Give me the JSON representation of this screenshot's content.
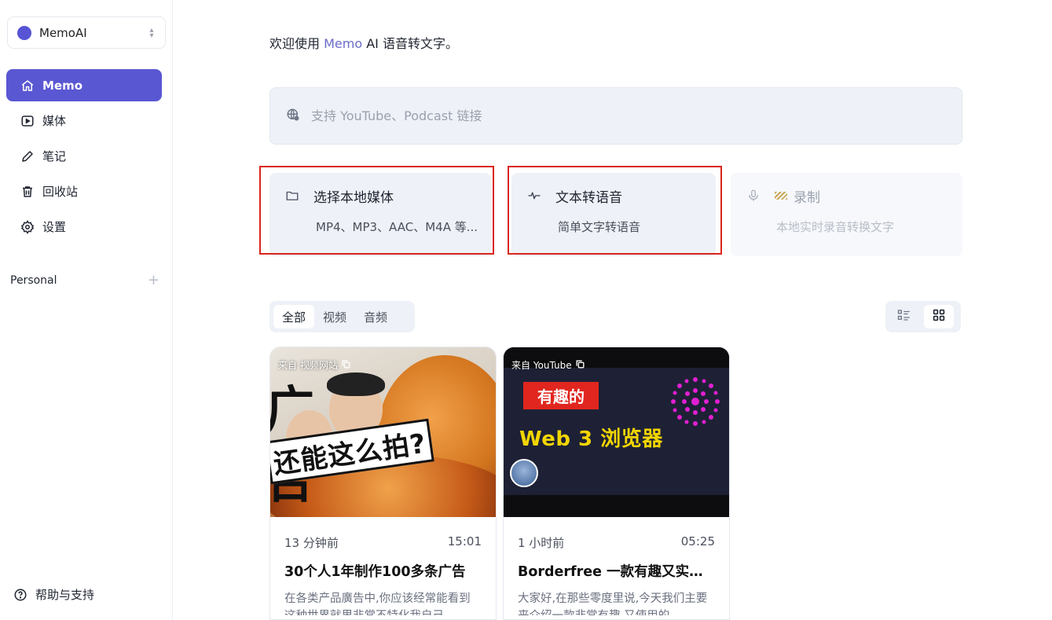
{
  "workspace": {
    "name": "MemoAI"
  },
  "sidebar": {
    "items": [
      {
        "label": "Memo",
        "icon": "home-icon",
        "active": true
      },
      {
        "label": "媒体",
        "icon": "play-icon",
        "active": false
      },
      {
        "label": "笔记",
        "icon": "pencil-icon",
        "active": false
      },
      {
        "label": "回收站",
        "icon": "trash-icon",
        "active": false
      },
      {
        "label": "设置",
        "icon": "gear-icon",
        "active": false
      }
    ],
    "section_label": "Personal",
    "help_label": "帮助与支持"
  },
  "main": {
    "welcome_prefix": "欢迎使用 ",
    "welcome_brand": "Memo",
    "welcome_suffix": " AI 语音转文字。",
    "url_placeholder": "支持 YouTube、Podcast 链接",
    "cards": [
      {
        "title": "选择本地媒体",
        "subtitle": "MP4、MP3、AAC、M4A 等...",
        "icon": "folder-icon"
      },
      {
        "title": "文本转语音",
        "subtitle": "简单文字转语音",
        "icon": "waveform-icon"
      },
      {
        "title": "录制",
        "subtitle": "本地实时录音转换文字",
        "icon": "microphone-icon"
      }
    ],
    "tabs": [
      {
        "label": "全部",
        "active": true
      },
      {
        "label": "视频",
        "active": false
      },
      {
        "label": "音频",
        "active": false
      }
    ],
    "media": [
      {
        "source": "来自 视频网站",
        "time_ago": "13 分钟前",
        "duration": "15:01",
        "title": "30个人1年制作100多条广告",
        "description": "在各类产品廣告中,你应该经常能看到这种世界就里非常不特化我自己",
        "thumb_text_top": "广 告",
        "thumb_text_bottom": "还能这么拍?"
      },
      {
        "source": "来自 YouTube",
        "time_ago": "1 小时前",
        "duration": "05:25",
        "title": "Borderfree 一款有趣又实用的",
        "description": "大家好,在那些零度里说,今天我们主要来介绍一款非常有趣,又使用的",
        "thumb_tag": "有趣的",
        "thumb_title": "Web 3 浏览器"
      }
    ]
  },
  "colors": {
    "accent": "#5a57d3",
    "highlight_box": "#d9251c",
    "card_bg": "#eef1f7"
  }
}
